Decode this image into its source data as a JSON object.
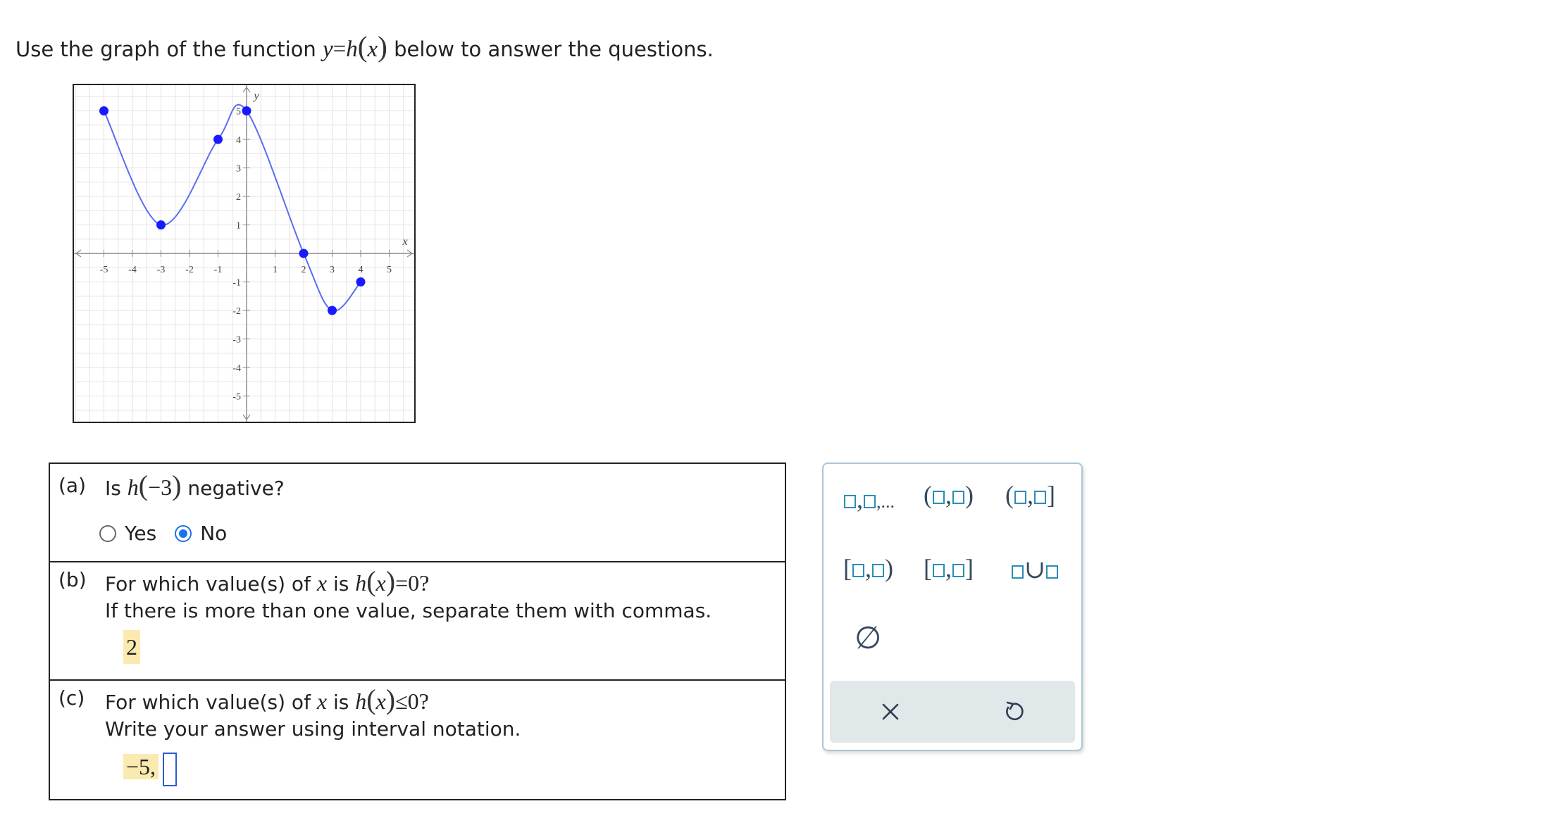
{
  "instruction": {
    "before": "Use the graph of the function",
    "func_y": "y",
    "func_eq": "=",
    "func_h": "h",
    "func_x": "x",
    "after": "below to answer the questions."
  },
  "graph": {
    "x_axis_label": "x",
    "y_axis_label": "y",
    "x_tick_labels": [
      "-5",
      "-4",
      "-3",
      "-2",
      "-1",
      "1",
      "2",
      "3",
      "4",
      "5"
    ],
    "y_tick_labels": [
      "5",
      "4",
      "3",
      "2",
      "1",
      "-1",
      "-2",
      "-3",
      "-4",
      "-5"
    ],
    "curve_color": "#5a6ef0",
    "point_color": "#1a1aff",
    "key_points": [
      [
        -5,
        5
      ],
      [
        -3,
        1
      ],
      [
        -1,
        4
      ],
      [
        0,
        5
      ],
      [
        2,
        0
      ],
      [
        3,
        -2
      ],
      [
        4,
        -1
      ]
    ]
  },
  "questions": {
    "a": {
      "label": "(a)",
      "text_is": "Is",
      "h": "h",
      "arg": "−3",
      "text_after": "negative?",
      "options": [
        "Yes",
        "No"
      ],
      "selected": "No"
    },
    "b": {
      "label": "(b)",
      "line1_before": "For which value(s) of",
      "x": "x",
      "line1_mid": "is",
      "h": "h",
      "line1_eq": "=0?",
      "line2": "If there is more than one value, separate them with commas.",
      "answer": "2"
    },
    "c": {
      "label": "(c)",
      "line1_before": "For which value(s) of",
      "x": "x",
      "line1_mid": "is",
      "h": "h",
      "line1_eq": "≤0?",
      "line2": "Write your answer using interval notation.",
      "answer": "−5,"
    }
  },
  "palette": {
    "list_dots": ",...",
    "comma": ",",
    "union": "∪",
    "empty_set": "∅",
    "clear_icon": "close-icon",
    "undo_icon": "undo-icon",
    "square_color": "#2a8eb5"
  }
}
